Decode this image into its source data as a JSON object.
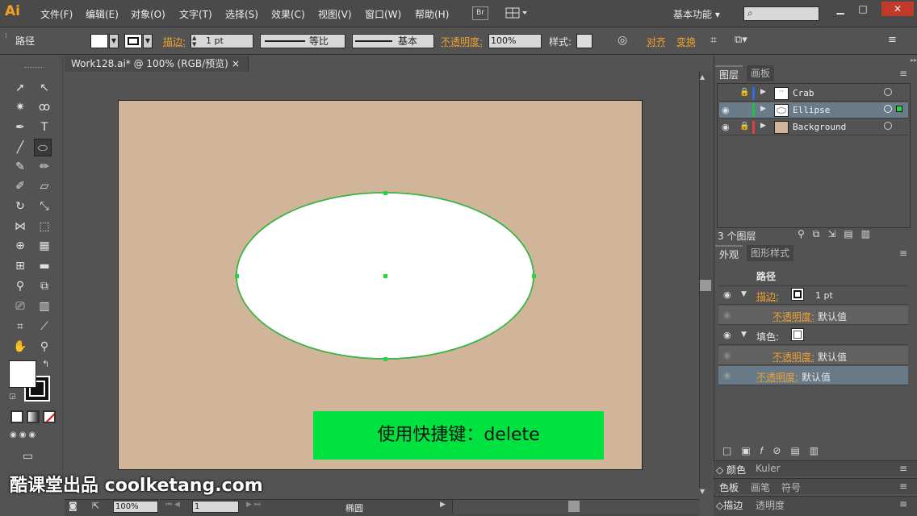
{
  "app": {
    "logo": "Ai",
    "menus": [
      "文件(F)",
      "编辑(E)",
      "对象(O)",
      "文字(T)",
      "选择(S)",
      "效果(C)",
      "视图(V)",
      "窗口(W)",
      "帮助(H)"
    ],
    "bridge": "Br",
    "workspace": "基本功能 ▾",
    "window_controls": [
      "▁",
      "□",
      "✕"
    ]
  },
  "control": {
    "object_type": "路径",
    "stroke_label": "描边:",
    "stroke_weight": "1 pt",
    "stroke_profile": "等比",
    "brush": "基本",
    "opacity_label": "不透明度:",
    "opacity": "100%",
    "style_label": "样式:",
    "align_label": "对齐",
    "transform_label": "变换"
  },
  "document": {
    "tab_title": "Work128.ai* @ 100% (RGB/预览)",
    "tab_close": "×"
  },
  "status": {
    "zoom": "100%",
    "page": "1",
    "tool_name": "椭圆"
  },
  "layers_panel": {
    "tabs": [
      "图层",
      "画板"
    ],
    "layers": [
      {
        "name": "Crab",
        "color": "#2d6de0",
        "visible": false,
        "locked": true
      },
      {
        "name": "Ellipse",
        "color": "#20c040",
        "visible": true,
        "locked": false,
        "selected": true
      },
      {
        "name": "Background",
        "color": "#e04040",
        "visible": true,
        "locked": true
      }
    ],
    "count": "3 个图层"
  },
  "appearance_panel": {
    "tabs": [
      "外观",
      "图形样式"
    ],
    "title": "路径",
    "stroke_label": "描边:",
    "stroke_value": "1 pt",
    "stroke_opacity_label": "不透明度:",
    "stroke_opacity_value": "默认值",
    "fill_label": "填色:",
    "fill_opacity_label": "不透明度:",
    "fill_opacity_value": "默认值",
    "opacity_label": "不透明度:",
    "opacity_value": "默认值"
  },
  "collapsed_panels": {
    "row1": [
      "颜色",
      "Kuler"
    ],
    "row2": [
      "色板",
      "画笔",
      "符号"
    ],
    "row3": [
      "描边",
      "透明度"
    ]
  },
  "overlay": {
    "banner": "使用快捷键：delete",
    "watermark": "酷课堂出品 coolketang.com"
  },
  "colors": {
    "selection": "#27d53e",
    "artboard": "#d0b59b",
    "banner": "#00e23f"
  }
}
